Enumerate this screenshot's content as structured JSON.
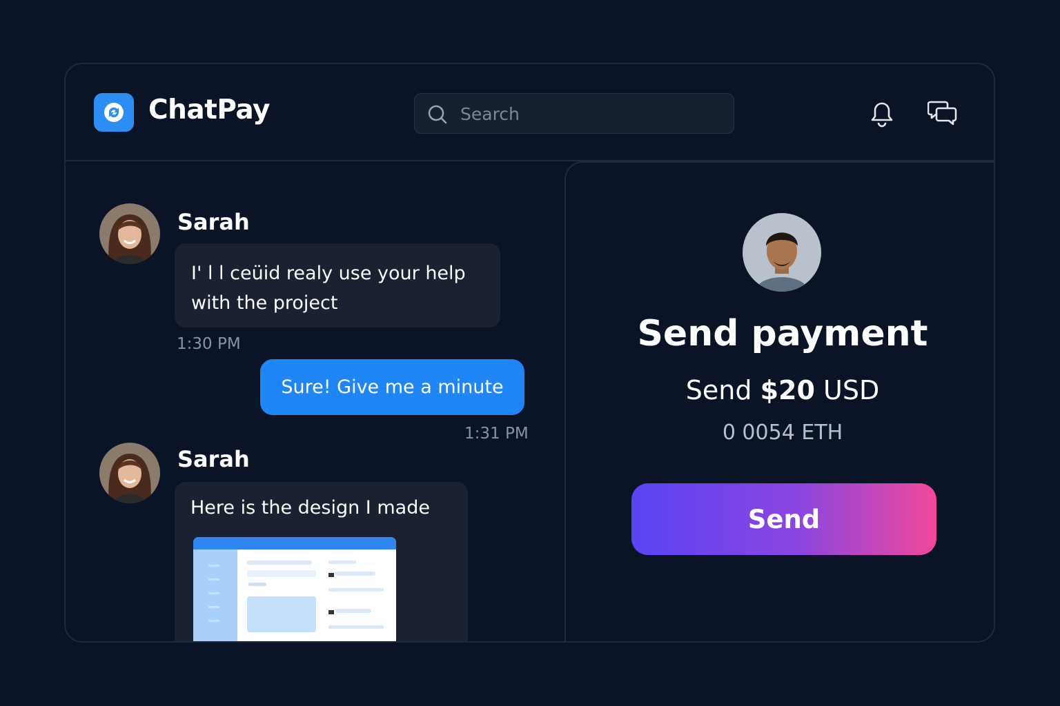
{
  "app": {
    "title": "ChatPay"
  },
  "search": {
    "placeholder": "Search"
  },
  "colors": {
    "background": "#0b1426",
    "accent": "#2086f5",
    "bubble_in": "#1a2231",
    "gradient_start": "#5a44f5",
    "gradient_end": "#f3489a"
  },
  "icons": [
    "chatpay-logo-icon",
    "search-icon",
    "bell-icon",
    "chat-bubbles-icon"
  ],
  "messages": [
    {
      "sender": "Sarah",
      "text_line1": "I' l l ceüid realy use your help",
      "text_line2": "with the project",
      "time": "1:30 PM"
    },
    {
      "sender": "me",
      "text": "Sure! Give me  a minute",
      "time": "1:31 PM"
    },
    {
      "sender": "Sarah",
      "text": "Here is the design I made"
    }
  ],
  "payment": {
    "title": "Send payment",
    "amount_prefix": "Send",
    "amount": "$20",
    "currency": "USD",
    "eth": "0 0054 ETH",
    "button_label": "Send"
  }
}
